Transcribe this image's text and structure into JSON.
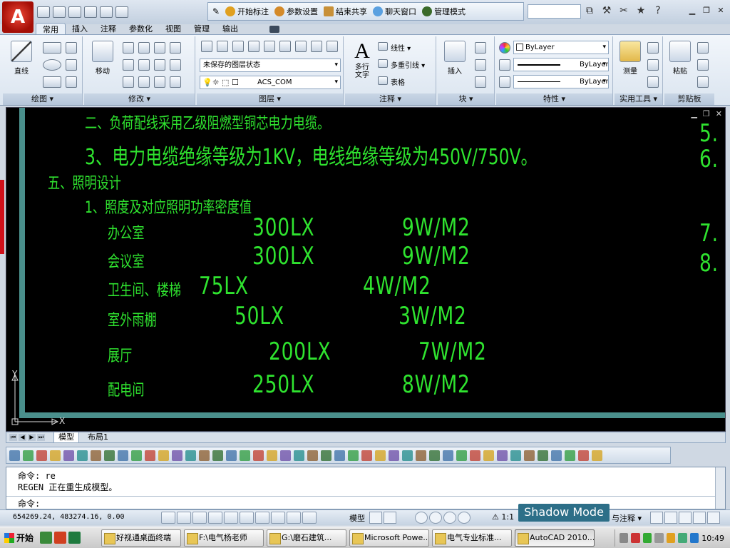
{
  "collab_toolbar": {
    "items": [
      {
        "label": "开始标注",
        "icon": "pen-icon"
      },
      {
        "label": "参数设置",
        "icon": "settings-icon"
      },
      {
        "label": "结束共享",
        "icon": "stop-share-icon"
      },
      {
        "label": "聊天窗口",
        "icon": "chat-icon"
      },
      {
        "label": "管理模式",
        "icon": "admin-icon"
      }
    ]
  },
  "ribbon": {
    "tabs": [
      "常用",
      "插入",
      "注释",
      "参数化",
      "视图",
      "管理",
      "输出"
    ],
    "active_tab": "常用",
    "panels": {
      "draw": {
        "label": "绘图 ▾",
        "line_button": "直线"
      },
      "modify": {
        "label": "修改 ▾",
        "move_button": "移动"
      },
      "layers": {
        "label": "图层 ▾",
        "layer_state": "未保存的图层状态",
        "current_layer": "ACS_COM"
      },
      "annotation": {
        "label": "注释 ▾",
        "text_button": "多行\n文字",
        "linear": "线性 ▾",
        "multileader": "多重引线 ▾",
        "table": "表格"
      },
      "block": {
        "label": "块 ▾",
        "insert_button": "插入"
      },
      "properties": {
        "label": "特性 ▾",
        "color": "ByLayer",
        "linetype": "ByLayer",
        "lineweight": "ByLayer"
      },
      "utilities": {
        "label": "实用工具 ▾",
        "measure_button": "测量"
      },
      "clipboard": {
        "label": "剪贴板",
        "paste_button": "粘贴"
      }
    }
  },
  "drawing": {
    "lines": [
      "二、负荷配线采用乙级阻燃型铜芯电力电缆。",
      "3、电力电缆绝缘等级为1KV，电线绝缘等级为450V/750V。",
      "五、照明设计",
      "1、照度及对应照明功率密度值"
    ],
    "rows": [
      {
        "room": "办公室",
        "lux": "300LX",
        "density": "9W/M2"
      },
      {
        "room": "会议室",
        "lux": "300LX",
        "density": "9W/M2"
      },
      {
        "room": "卫生间、楼梯",
        "lux": "75LX",
        "density": "4W/M2"
      },
      {
        "room": "室外雨棚",
        "lux": "50LX",
        "density": "3W/M2"
      },
      {
        "room": "展厅",
        "lux": "200LX",
        "density": "7W/M2"
      },
      {
        "room": "配电间",
        "lux": "250LX",
        "density": "8W/M2"
      }
    ],
    "right_numbers": [
      "5.",
      "6.",
      "7.",
      "8."
    ],
    "axis_y": "Y",
    "axis_x": "X"
  },
  "layout_tabs": [
    "模型",
    "布局1"
  ],
  "command_line": {
    "lines": [
      "命令: re",
      "REGEN 正在重生成模型。"
    ],
    "prompt": "命令:"
  },
  "status_bar": {
    "coords": "654269.24, 483274.16, 0.00",
    "model": "模型",
    "scale": "1:1",
    "annotation": "与注释 ▾"
  },
  "overlay": {
    "shadow_mode": "Shadow Mode"
  },
  "taskbar": {
    "start": "开始",
    "tasks": [
      "好视通桌面终端",
      "F:\\电气杨老师",
      "G:\\磨石建筑...",
      "Microsoft Powe...",
      "电气专业标准...",
      "AutoCAD 2010..."
    ],
    "clock": "10:49"
  },
  "colors": {
    "drawing_text": "#2fe32f",
    "drawing_bg": "#000000",
    "frame_line": "#4a8f8c",
    "shadow_mode_bg": "#2d6f88"
  }
}
